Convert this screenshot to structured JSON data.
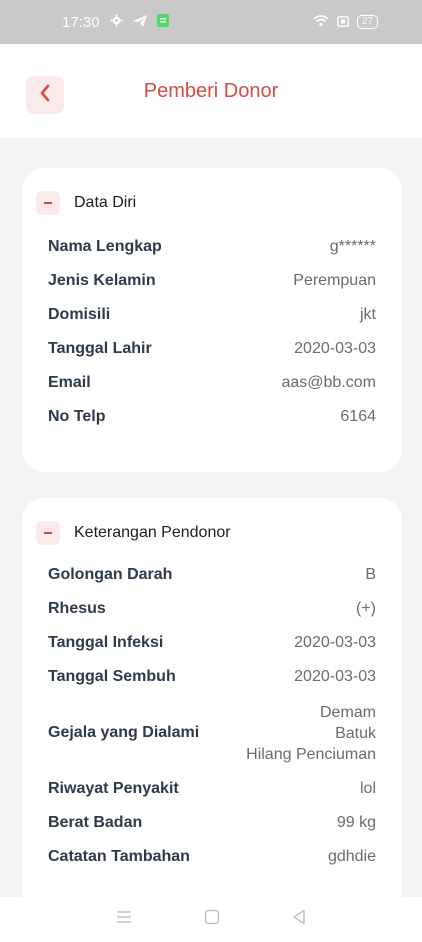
{
  "status_bar": {
    "time": "17:30",
    "battery": "27",
    "icons": [
      "gear-icon",
      "telegram-icon",
      "app-icon",
      "wifi-icon",
      "sim-icon",
      "battery-icon"
    ]
  },
  "header": {
    "title": "Pemberi Donor",
    "back_icon": "chevron-left-icon"
  },
  "data_diri": {
    "title": "Data Diri",
    "rows": [
      {
        "label": "Nama Lengkap",
        "value": "g******"
      },
      {
        "label": "Jenis Kelamin",
        "value": "Perempuan"
      },
      {
        "label": "Domisili",
        "value": "jkt"
      },
      {
        "label": "Tanggal Lahir",
        "value": "2020-03-03"
      },
      {
        "label": "Email",
        "value": "aas@bb.com"
      },
      {
        "label": "No Telp",
        "value": "6164"
      }
    ]
  },
  "keterangan": {
    "title": "Keterangan Pendonor",
    "rows": [
      {
        "label": "Golongan Darah",
        "value": "B"
      },
      {
        "label": "Rhesus",
        "value": "(+)"
      },
      {
        "label": "Tanggal Infeksi",
        "value": "2020-03-03"
      },
      {
        "label": "Tanggal Sembuh",
        "value": "2020-03-03"
      },
      {
        "label": "Gejala yang Dialami",
        "values": [
          "Demam",
          "Batuk",
          "Hilang Penciuman"
        ]
      },
      {
        "label": "Riwayat Penyakit",
        "value": "lol"
      },
      {
        "label": "Berat Badan",
        "value": "99 kg"
      },
      {
        "label": "Catatan Tambahan",
        "value": "gdhdie"
      }
    ]
  },
  "colors": {
    "accent": "#d84a43",
    "accent_light": "#fbeaea",
    "label": "#2e3a4a",
    "value": "#6b6b6b",
    "background": "#f3f3f5"
  }
}
